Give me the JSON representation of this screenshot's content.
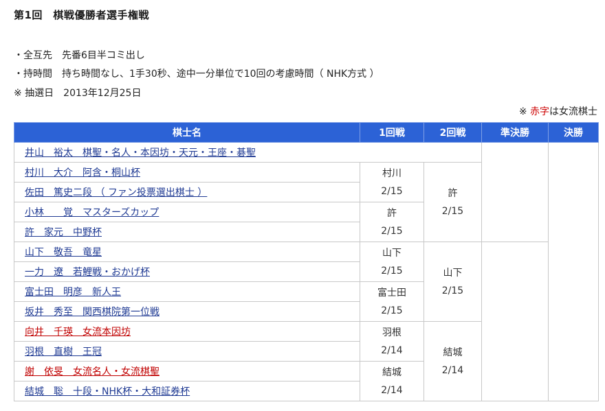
{
  "page": {
    "title": "第1回　棋戦優勝者選手権戦",
    "info_lines": [
      "・全互先　先番6目半コミ出し",
      "・持時間　持ち時間なし、1手30秒、途中一分単位で10回の考慮時間（ NHK方式 ）",
      "※ 抽選日　2013年12月25日"
    ],
    "note_prefix": "※ ",
    "note_red": "赤字",
    "note_suffix": "は女流棋士"
  },
  "table": {
    "headers": [
      "棋士名",
      "1回戦",
      "2回戦",
      "準決勝",
      "決勝"
    ],
    "seed": "井山　裕太　棋聖・名人・本因坊・天元・王座・碁聖",
    "players": [
      {
        "name": "村川　大介　阿含・桐山杯",
        "female": false
      },
      {
        "name": "佐田　篤史二段 （ ファン投票選出棋士 ）",
        "female": false
      },
      {
        "name": "小林　　覚　マスターズカップ",
        "female": false
      },
      {
        "name": "許　家元　中野杯",
        "female": false
      },
      {
        "name": "山下　敬吾　竜星",
        "female": false
      },
      {
        "name": "一力　遼　若鯉戦・おかげ杯",
        "female": false
      },
      {
        "name": "富士田　明彦　新人王",
        "female": false
      },
      {
        "name": "坂井　秀至　関西棋院第一位戦",
        "female": false
      },
      {
        "name": "向井　千瑛　女流本因坊",
        "female": true
      },
      {
        "name": "羽根　直樹　王冠",
        "female": false
      },
      {
        "name": "謝　依旻　女流名人・女流棋聖",
        "female": true
      },
      {
        "name": "結城　聡　十段・NHK杯・大和証券杯",
        "female": false
      }
    ],
    "round1": [
      {
        "winner": "村川",
        "date": "2/15"
      },
      {
        "winner": "許",
        "date": "2/15"
      },
      {
        "winner": "山下",
        "date": "2/15"
      },
      {
        "winner": "富士田",
        "date": "2/15"
      },
      {
        "winner": "羽根",
        "date": "2/14"
      },
      {
        "winner": "結城",
        "date": "2/14"
      }
    ],
    "round2": [
      {
        "winner": "許",
        "date": "2/15"
      },
      {
        "winner": "山下",
        "date": "2/15"
      },
      {
        "winner": "結城",
        "date": "2/14"
      }
    ]
  },
  "colors": {
    "header_bg": "#2c62d6",
    "link": "#1f3a93",
    "female": "#c00000"
  }
}
